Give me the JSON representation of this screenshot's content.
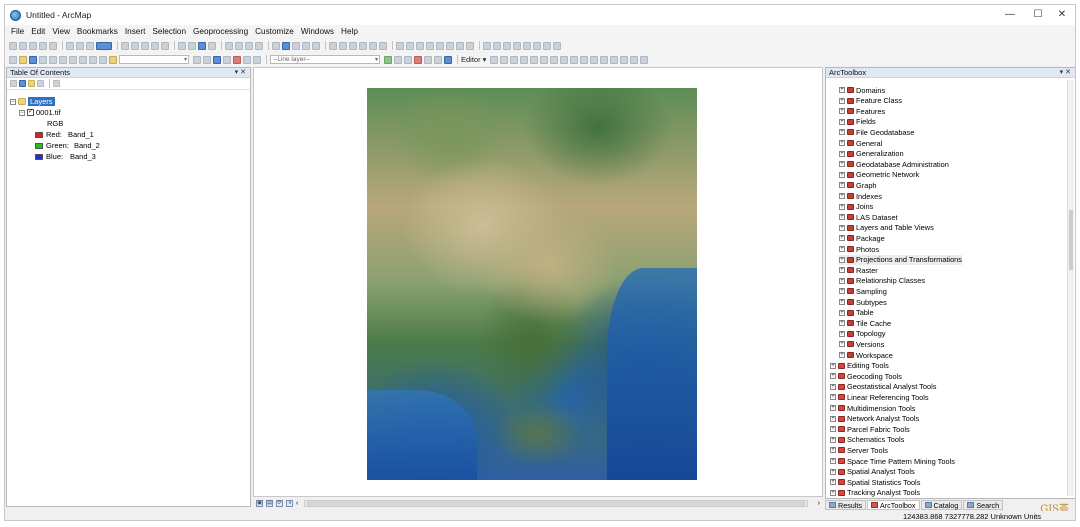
{
  "window": {
    "title": "Untitled - ArcMap",
    "minimize": "—",
    "maximize": "☐",
    "close": "✕"
  },
  "menu": [
    "File",
    "Edit",
    "View",
    "Bookmarks",
    "Insert",
    "Selection",
    "Geoprocessing",
    "Customize",
    "Windows",
    "Help"
  ],
  "toolbar": {
    "line_layer": "--Line layer--",
    "editor_label": "Editor ▾"
  },
  "toc": {
    "header": "Table Of Contents",
    "pin": "▾ ✕",
    "root": "Layers",
    "layer": "0001.tif",
    "renderer": "RGB",
    "bands": [
      {
        "label": "Red:",
        "value": "Band_1",
        "color": "#e02020"
      },
      {
        "label": "Green:",
        "value": "Band_2",
        "color": "#20c020"
      },
      {
        "label": "Blue:",
        "value": "Band_3",
        "color": "#2030d0"
      }
    ]
  },
  "toolbox": {
    "header": "ArcToolbox",
    "pin": "▾ ✕",
    "data_management_subsets": [
      "Domains",
      "Feature Class",
      "Features",
      "Fields",
      "File Geodatabase",
      "General",
      "Generalization",
      "Geodatabase Administration",
      "Geometric Network",
      "Graph",
      "Indexes",
      "Joins",
      "LAS Dataset",
      "Layers and Table Views",
      "Package",
      "Photos",
      "Projections and Transformations",
      "Raster",
      "Relationship Classes",
      "Sampling",
      "Subtypes",
      "Table",
      "Tile Cache",
      "Topology",
      "Versions",
      "Workspace"
    ],
    "toolsets": [
      "Editing Tools",
      "Geocoding Tools",
      "Geostatistical Analyst Tools",
      "Linear Referencing Tools",
      "Multidimension Tools",
      "Network Analyst Tools",
      "Parcel Fabric Tools",
      "Schematics Tools",
      "Server Tools",
      "Space Time Pattern Mining Tools",
      "Spatial Analyst Tools",
      "Spatial Statistics Tools",
      "Tracking Analyst Tools"
    ],
    "highlighted": "Projections and Transformations"
  },
  "tabs": [
    "Results",
    "ArcToolbox",
    "Catalog",
    "Search"
  ],
  "status": {
    "coords": "124383.868  7327778.282 Unknown Units"
  },
  "watermark": "GIS荟"
}
